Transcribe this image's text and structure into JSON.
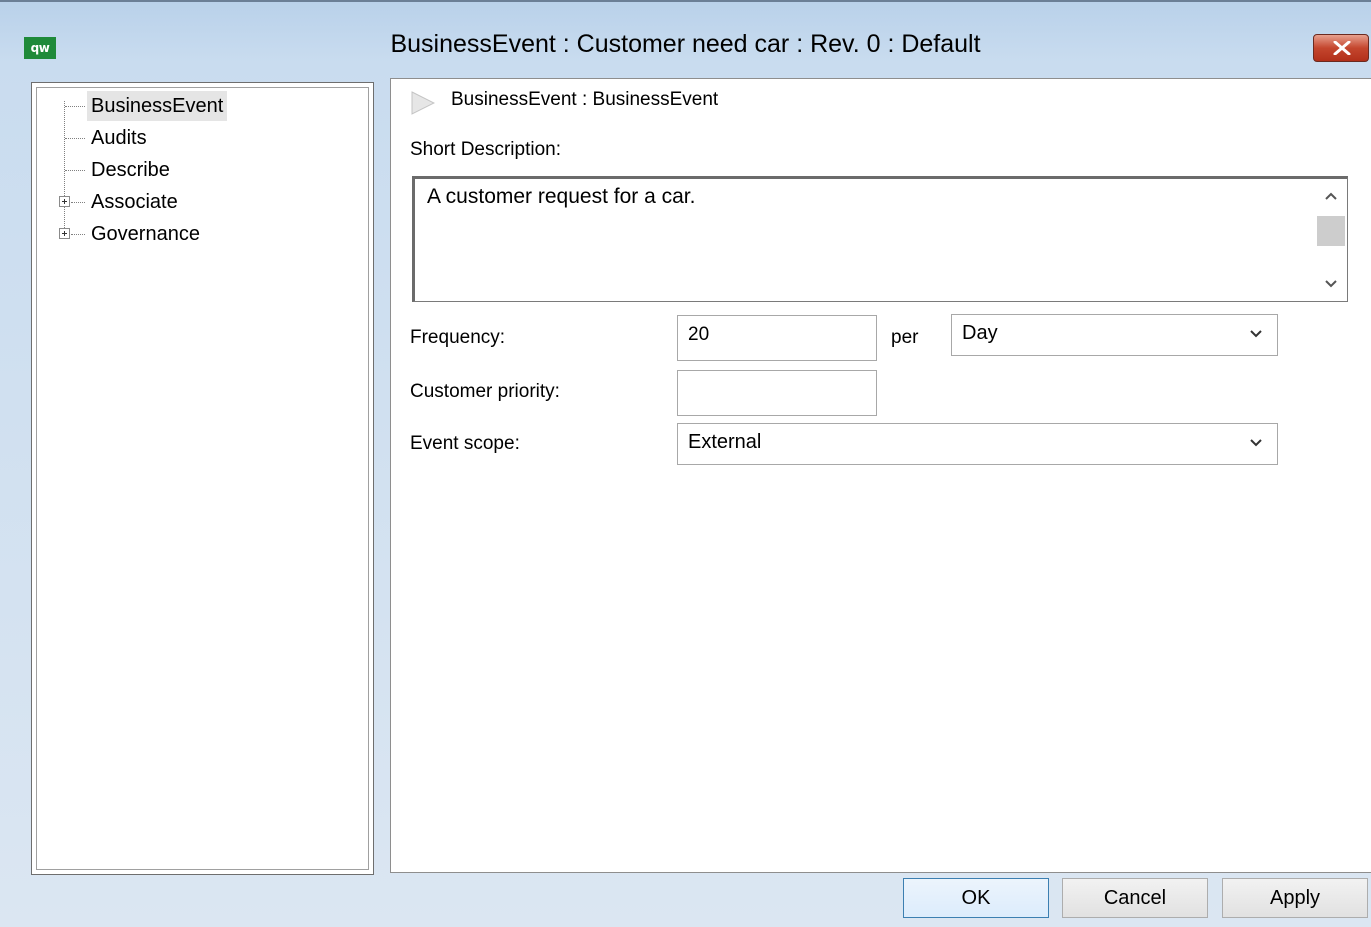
{
  "window": {
    "title": "BusinessEvent : Customer need car : Rev. 0  : Default",
    "app_icon_text": "qw"
  },
  "tree": {
    "items": [
      {
        "label": "BusinessEvent",
        "expandable": false,
        "selected": true
      },
      {
        "label": "Audits",
        "expandable": false,
        "selected": false
      },
      {
        "label": "Describe",
        "expandable": false,
        "selected": false
      },
      {
        "label": "Associate",
        "expandable": true,
        "selected": false
      },
      {
        "label": "Governance",
        "expandable": true,
        "selected": false
      }
    ]
  },
  "main": {
    "breadcrumb": "BusinessEvent : BusinessEvent",
    "short_description_label": "Short Description:",
    "short_description_value": "A customer request for a car.",
    "frequency_label": "Frequency:",
    "frequency_value": "20",
    "per_label": "per",
    "frequency_unit": "Day",
    "customer_priority_label": "Customer priority:",
    "customer_priority_value": "",
    "event_scope_label": "Event scope:",
    "event_scope_value": "External"
  },
  "buttons": {
    "ok": "OK",
    "cancel": "Cancel",
    "apply": "Apply"
  }
}
